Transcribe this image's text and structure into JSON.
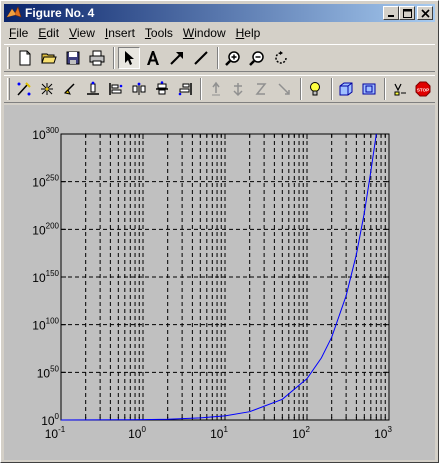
{
  "window": {
    "title": "Figure No. 4",
    "icon": "matlab-logo-icon"
  },
  "menu": [
    {
      "label": "File",
      "mnemonic": "F",
      "rest": "ile"
    },
    {
      "label": "Edit",
      "mnemonic": "E",
      "rest": "dit"
    },
    {
      "label": "View",
      "mnemonic": "V",
      "rest": "iew"
    },
    {
      "label": "Insert",
      "mnemonic": "I",
      "rest": "nsert"
    },
    {
      "label": "Tools",
      "mnemonic": "T",
      "rest": "ools"
    },
    {
      "label": "Window",
      "mnemonic": "W",
      "rest": "indow"
    },
    {
      "label": "Help",
      "mnemonic": "H",
      "rest": "elp"
    }
  ],
  "toolbar1": [
    "new-file-icon",
    "open-folder-icon",
    "save-icon",
    "print-icon",
    "select-arrow-icon",
    "insert-text-icon",
    "insert-arrow-icon",
    "insert-line-icon",
    "zoom-in-icon",
    "zoom-out-icon",
    "rotate-icon"
  ],
  "toolbar2": [
    "edit-plot-icon",
    "show-points-icon",
    "point-icon",
    "align-bottom-icon",
    "align-left-icon",
    "distribute-icon",
    "align-center-icon",
    "align-right-icon",
    "camera-orbit-icon",
    "camera-pan-icon",
    "camera-zoom-icon",
    "camera-roll-icon",
    "light-icon",
    "box-3d-icon",
    "box-ortho-icon",
    "legend-icon",
    "stop-icon"
  ],
  "chart_data": {
    "type": "line",
    "xscale": "log",
    "yscale": "log",
    "xlim": [
      0.1,
      1000
    ],
    "ylim": [
      1,
      1e+300
    ],
    "grid": true,
    "xticks": [
      {
        "base": "10",
        "exp": "-1"
      },
      {
        "base": "10",
        "exp": "0"
      },
      {
        "base": "10",
        "exp": "1"
      },
      {
        "base": "10",
        "exp": "2"
      },
      {
        "base": "10",
        "exp": "3"
      }
    ],
    "yticks": [
      {
        "base": "10",
        "exp": "0"
      },
      {
        "base": "10",
        "exp": "50"
      },
      {
        "base": "10",
        "exp": "100"
      },
      {
        "base": "10",
        "exp": "150"
      },
      {
        "base": "10",
        "exp": "200"
      },
      {
        "base": "10",
        "exp": "250"
      },
      {
        "base": "10",
        "exp": "300"
      }
    ],
    "series": [
      {
        "color": "#0000ff",
        "x": [
          0.1,
          0.5,
          1,
          2,
          5,
          10,
          20,
          50,
          100,
          150,
          200,
          300,
          400,
          500,
          600,
          700
        ],
        "log10_y": [
          0.04,
          0.22,
          0.43,
          0.87,
          2.17,
          4.34,
          8.69,
          21.7,
          43.4,
          65.1,
          86.9,
          130.3,
          173.7,
          217.1,
          260.6,
          304.0
        ]
      }
    ]
  }
}
